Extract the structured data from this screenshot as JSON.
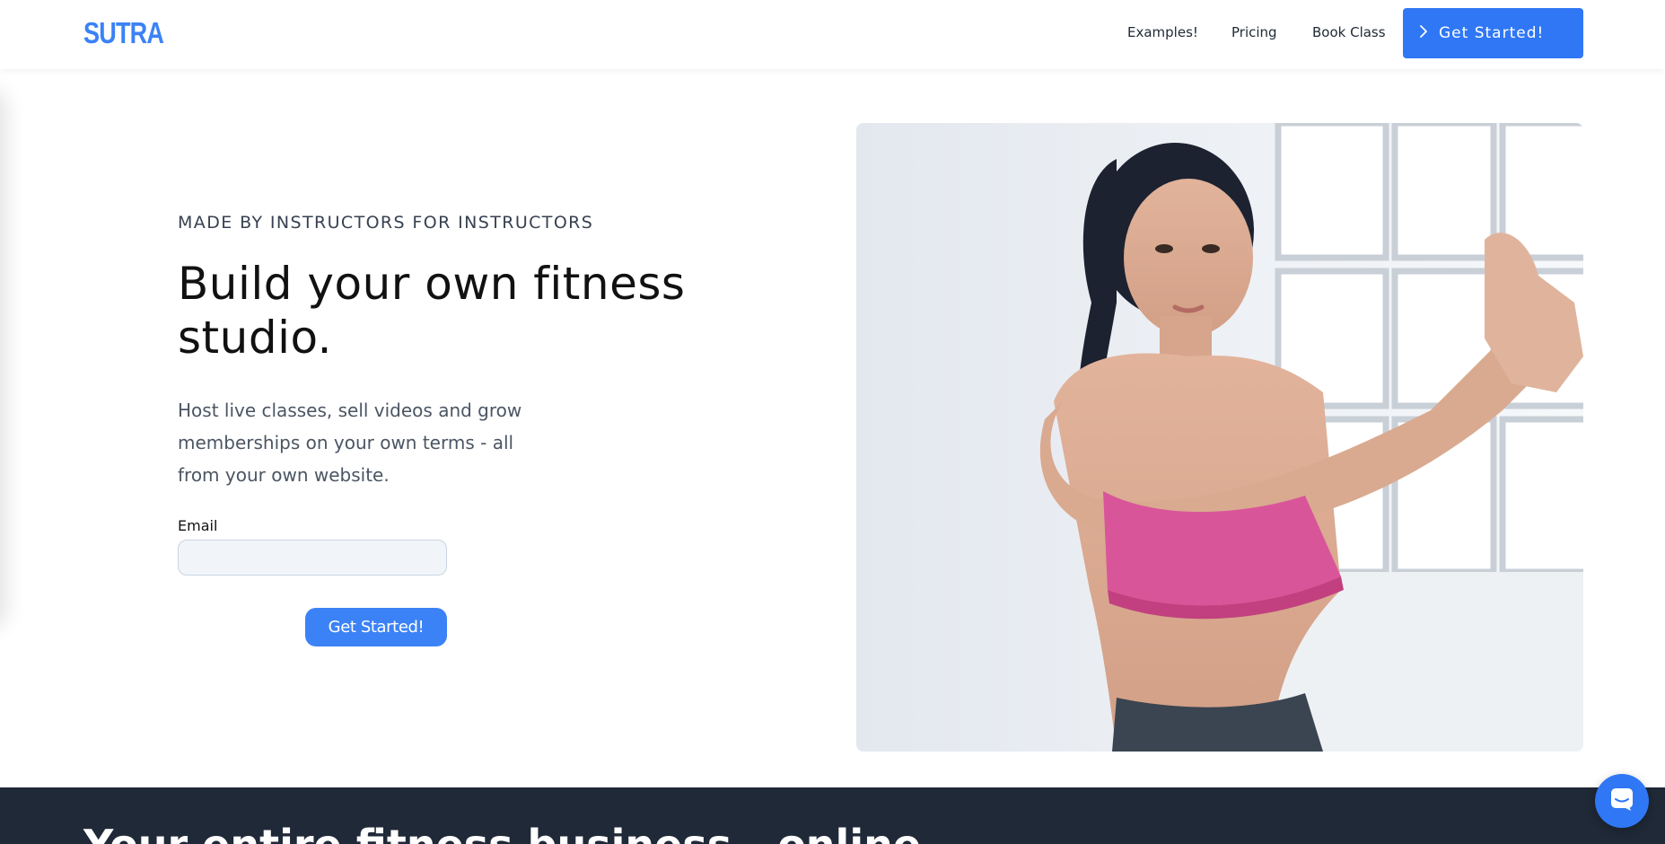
{
  "navbar": {
    "logo": "SUTRA",
    "links": [
      "Examples!",
      "Pricing",
      "Book Class"
    ],
    "cta_label": "Get Started!",
    "cta_icon": "chevron-right-icon"
  },
  "hero": {
    "eyebrow": "MADE BY INSTRUCTORS FOR INSTRUCTORS",
    "title": "Build your own fitness studio.",
    "subtitle": "Host live classes, sell videos and grow memberships on your own terms - all from your own website.",
    "email_label": "Email",
    "email_value": "",
    "email_placeholder": "",
    "cta_label": "Get Started!",
    "image_icon": "woman-stretching-photo"
  },
  "band": {
    "heading": "Your entire fitness business - online"
  },
  "chat": {
    "icon": "chat-icon"
  },
  "colors": {
    "brand_blue": "#3b82f6",
    "nav_cta_blue": "#2f77f5",
    "dark_band": "#1f2937",
    "text_dark": "#111111",
    "text_muted": "#4b5563"
  }
}
